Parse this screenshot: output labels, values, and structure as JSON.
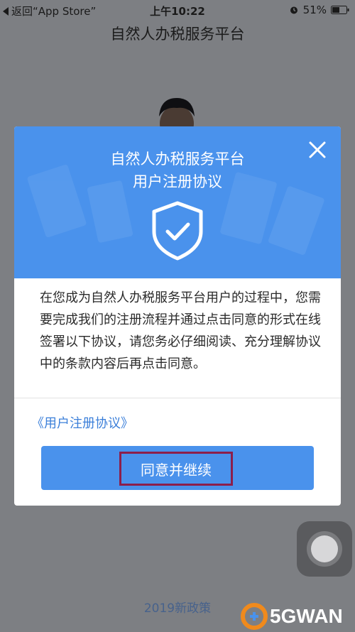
{
  "status_bar": {
    "back_label": "返回“App Store”",
    "time": "上午10:22",
    "battery": "51%"
  },
  "app": {
    "title": "自然人办税服务平台"
  },
  "background": {
    "bottom_text": "2019新政策"
  },
  "dialog": {
    "title_line1": "自然人办税服务平台",
    "title_line2": "用户注册协议",
    "body_text": "在您成为自然人办税服务平台用户的过程中，您需要完成我们的注册流程并通过点击同意的形式在线签署以下协议，请您务必仔细阅读、充分理解协议中的条款内容后再点击同意。",
    "agreement_link": "《用户注册协议》",
    "agree_button_label": "同意并继续",
    "header_color": "#4a92ec",
    "highlight_color": "#8c1e4b"
  },
  "watermark": {
    "text": "5GWAN"
  },
  "icons": [
    "back-triangle-icon",
    "alarm-icon",
    "battery-icon",
    "avatar-icon",
    "close-icon",
    "shield-check-icon",
    "assistive-touch-icon",
    "watermark-logo-icon"
  ]
}
